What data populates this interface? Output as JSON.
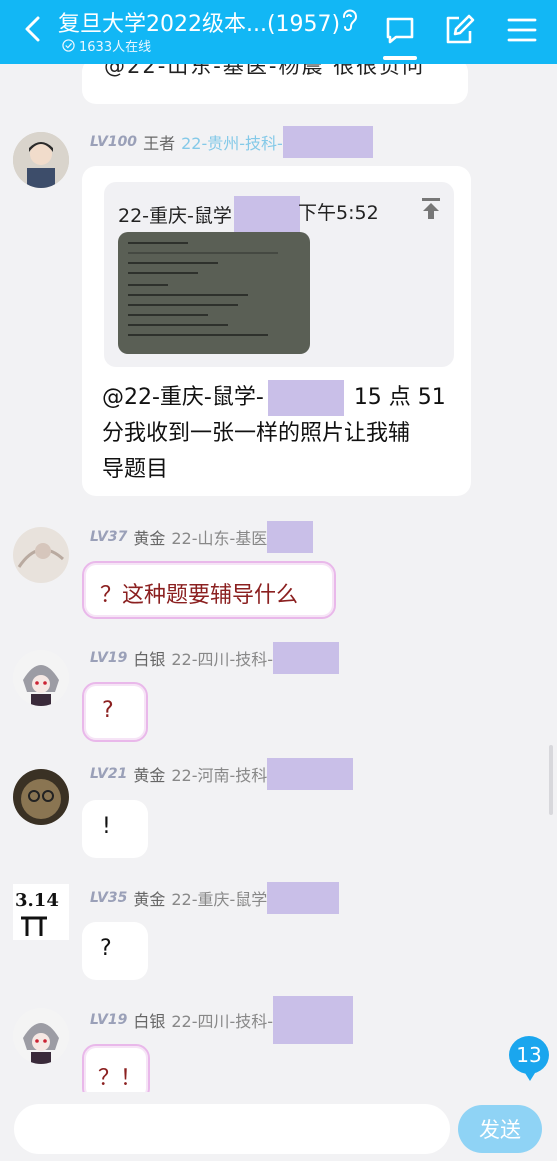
{
  "header": {
    "title": "复旦大学2022级本...(1957)",
    "online": "1633人在线",
    "icons": [
      "back-arrow-icon",
      "ear-icon",
      "chat-icon",
      "edit-icon",
      "menu-icon"
    ]
  },
  "prev_message_fragment": "@22-山东-基医-杨晨 很很负问",
  "messages": [
    {
      "level": "LV100",
      "rank": "王者",
      "name": "22-贵州-技科-",
      "quote": {
        "sender": "22-重庆-鼠学",
        "time": "下午5:52"
      },
      "text_line1_prefix": "@22-重庆-鼠学-",
      "text_line1_suffix": "15 点 51",
      "text_line2": "分我收到一张一样的照片让我辅",
      "text_line3": "导题目"
    },
    {
      "level": "LV37",
      "rank": "黄金",
      "name": "22-山东-基医",
      "text": "？这种题要辅导什么"
    },
    {
      "level": "LV19",
      "rank": "白银",
      "name": "22-四川-技科-",
      "text": "?"
    },
    {
      "level": "LV21",
      "rank": "黄金",
      "name": "22-河南-技科",
      "text": "!"
    },
    {
      "level": "LV35",
      "rank": "黄金",
      "name": "22-重庆-鼠学",
      "text": "?"
    },
    {
      "level": "LV19",
      "rank": "白银",
      "name": "22-四川-技科-",
      "text": "？！"
    }
  ],
  "unread_count": "13",
  "input": {
    "placeholder": "",
    "send_label": "发送"
  },
  "colors": {
    "header": "#12b7f5",
    "send_button": "#8fd3f5",
    "redaction": "#c9bfe8"
  }
}
